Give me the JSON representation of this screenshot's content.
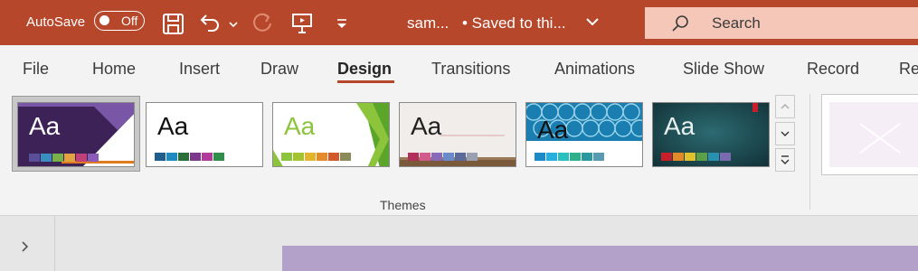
{
  "titlebar": {
    "autosave_label": "AutoSave",
    "autosave_state": "Off",
    "doc_title": "sam...",
    "save_status": "• Saved to thi...",
    "search_placeholder": "Search",
    "accent": "#b7472a"
  },
  "tabs": [
    {
      "label": "File"
    },
    {
      "label": "Home"
    },
    {
      "label": "Insert"
    },
    {
      "label": "Draw"
    },
    {
      "label": "Design",
      "active": true
    },
    {
      "label": "Transitions"
    },
    {
      "label": "Animations"
    },
    {
      "label": "Slide Show"
    },
    {
      "label": "Record"
    },
    {
      "label": "Re"
    }
  ],
  "themes": {
    "group_label": "Themes",
    "thumb_text": "Aa"
  }
}
